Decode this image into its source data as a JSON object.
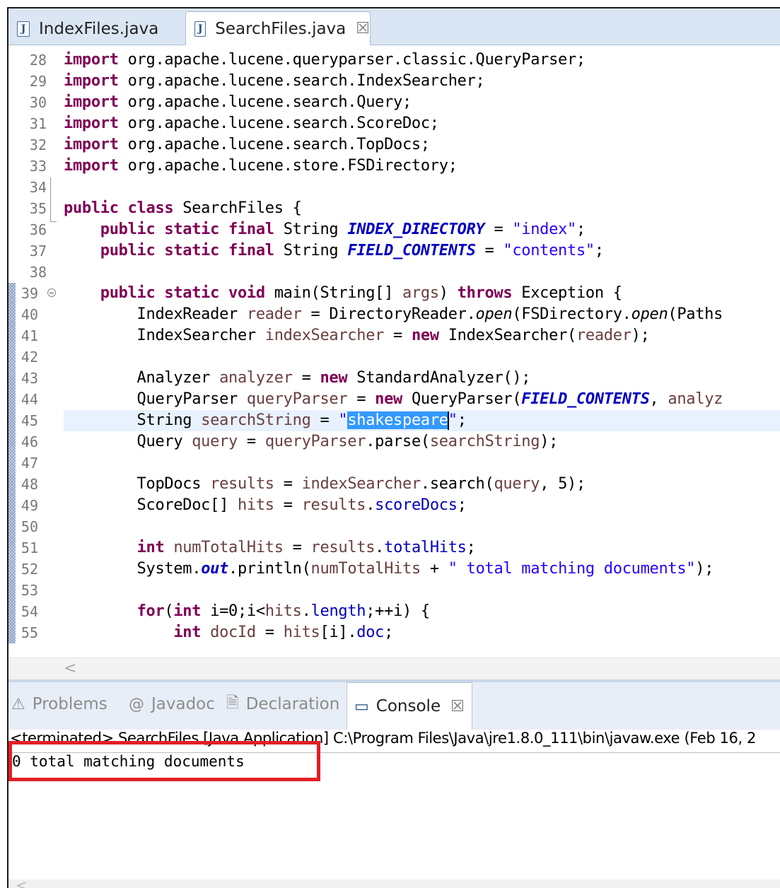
{
  "editor_tabs": [
    {
      "label": "IndexFiles.java",
      "active": false
    },
    {
      "label": "SearchFiles.java",
      "active": true,
      "close": "☒"
    }
  ],
  "gutter": [
    "28",
    "29",
    "30",
    "31",
    "32",
    "33",
    "34",
    "35",
    "36",
    "37",
    "38",
    "39",
    "40",
    "41",
    "42",
    "43",
    "44",
    "45",
    "46",
    "47",
    "48",
    "49",
    "50",
    "51",
    "52",
    "53",
    "54",
    "55"
  ],
  "code": {
    "l28": [
      "import",
      " org.apache.lucene.queryparser.classic.QueryParser;"
    ],
    "l29": [
      "import",
      " org.apache.lucene.search.IndexSearcher;"
    ],
    "l30": [
      "import",
      " org.apache.lucene.search.Query;"
    ],
    "l31": [
      "import",
      " org.apache.lucene.search.ScoreDoc;"
    ],
    "l32": [
      "import",
      " org.apache.lucene.search.TopDocs;"
    ],
    "l33": [
      "import",
      " org.apache.lucene.store.FSDirectory;"
    ],
    "l35": [
      "public class",
      " SearchFiles {"
    ],
    "l36": [
      "    public static final",
      " String ",
      "INDEX_DIRECTORY",
      " = ",
      "\"index\"",
      ";"
    ],
    "l37": [
      "    public static final",
      " String ",
      "FIELD_CONTENTS",
      " = ",
      "\"contents\"",
      ";"
    ],
    "l39": [
      "    public static void",
      " main(String[] ",
      "args",
      ") ",
      "throws",
      " Exception {"
    ],
    "l40": [
      "        IndexReader ",
      "reader",
      " = DirectoryReader.",
      "open",
      "(FSDirectory.",
      "open",
      "(Paths"
    ],
    "l41": [
      "        IndexSearcher ",
      "indexSearcher",
      " = ",
      "new",
      " IndexSearcher(",
      "reader",
      ");"
    ],
    "l43": [
      "        Analyzer ",
      "analyzer",
      " = ",
      "new",
      " StandardAnalyzer();"
    ],
    "l44": [
      "        QueryParser ",
      "queryParser",
      " = ",
      "new",
      " QueryParser(",
      "FIELD_CONTENTS",
      ", ",
      "analyz"
    ],
    "l45": [
      "        String ",
      "searchString",
      " = ",
      "\"",
      "shakespeare",
      "\"",
      ";"
    ],
    "l46": [
      "        Query ",
      "query",
      " = ",
      "queryParser",
      ".parse(",
      "searchString",
      ");"
    ],
    "l48": [
      "        TopDocs ",
      "results",
      " = ",
      "indexSearcher",
      ".search(",
      "query",
      ", 5);"
    ],
    "l49": [
      "        ScoreDoc[] ",
      "hits",
      " = ",
      "results",
      ".",
      "scoreDocs",
      ";"
    ],
    "l51": [
      "        ",
      "int",
      " ",
      "numTotalHits",
      " = ",
      "results",
      ".",
      "totalHits",
      ";"
    ],
    "l52": [
      "        System.",
      "out",
      ".println(",
      "numTotalHits",
      " + ",
      "\" total matching documents\"",
      ");"
    ],
    "l54": [
      "        ",
      "for",
      "(",
      "int",
      " i=0;i<",
      "hits",
      ".",
      "length",
      ";++i) {"
    ],
    "l55": [
      "            ",
      "int",
      " ",
      "docId",
      " = ",
      "hits",
      "[i].",
      "doc",
      ";"
    ]
  },
  "views": {
    "tabs": [
      "Problems",
      "Javadoc",
      "Declaration",
      "Console"
    ],
    "active": "Console",
    "close": "☒"
  },
  "console": {
    "status": "<terminated> SearchFiles [Java Application] C:\\Program Files\\Java\\jre1.8.0_111\\bin\\javaw.exe (Feb 16, 2",
    "output": "0 total matching documents"
  },
  "scroll_arrow": "<",
  "colors": {
    "keyword": "#7f0055",
    "string": "#2a00ff",
    "field": "#0000c0",
    "local_var": "#6a3e3e",
    "selection": "#3399ff",
    "highlight_box": "#e21f26"
  }
}
